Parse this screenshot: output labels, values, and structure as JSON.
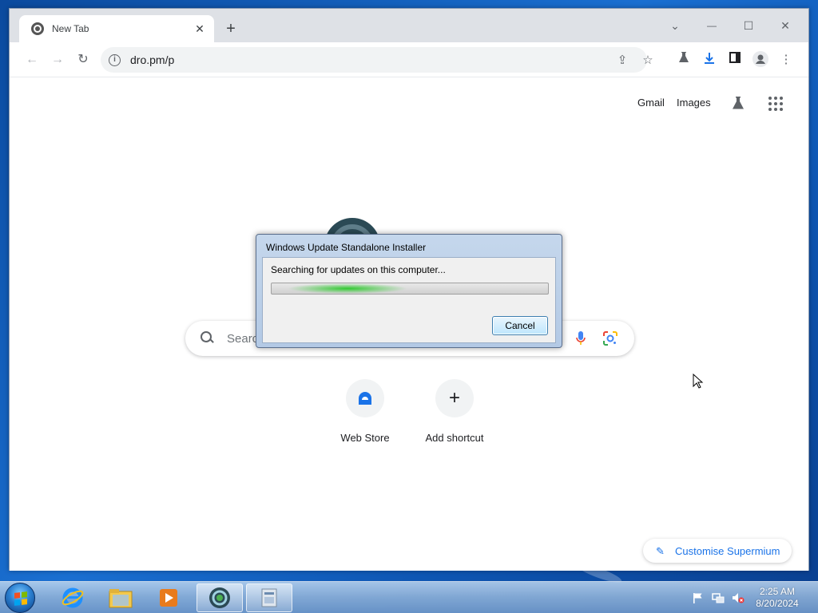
{
  "browser": {
    "tab": {
      "title": "New Tab",
      "close": "✕"
    },
    "new_tab": "+",
    "window_controls": {
      "dropdown": "⌄",
      "minimize": "—",
      "maximize": "☐",
      "close": "✕"
    },
    "toolbar": {
      "url": "dro.pm/p",
      "info": "i"
    }
  },
  "newtab_page": {
    "links": {
      "gmail": "Gmail",
      "images": "Images"
    },
    "search": {
      "placeholder": "Searc"
    },
    "shortcuts": [
      {
        "label": "Web Store",
        "icon": "web-store-icon"
      },
      {
        "label": "Add shortcut",
        "icon": "plus-icon",
        "glyph": "+"
      }
    ],
    "customise": "Customise Supermium"
  },
  "dialog": {
    "title": "Windows Update Standalone Installer",
    "message": "Searching for updates on this computer...",
    "progress": {
      "indeterminate": true,
      "glow_color": "#28c828"
    },
    "cancel": "Cancel"
  },
  "taskbar": {
    "apps": [
      {
        "name": "internet-explorer-icon",
        "active": false
      },
      {
        "name": "file-explorer-icon",
        "active": false
      },
      {
        "name": "media-player-icon",
        "active": false
      },
      {
        "name": "supermium-browser-icon",
        "active": true
      },
      {
        "name": "installer-icon",
        "active": true
      }
    ],
    "clock": {
      "time": "2:25 AM",
      "date": "8/20/2024"
    }
  },
  "colors": {
    "accent": "#1a73e8",
    "desktop": "#1a6fd1"
  }
}
